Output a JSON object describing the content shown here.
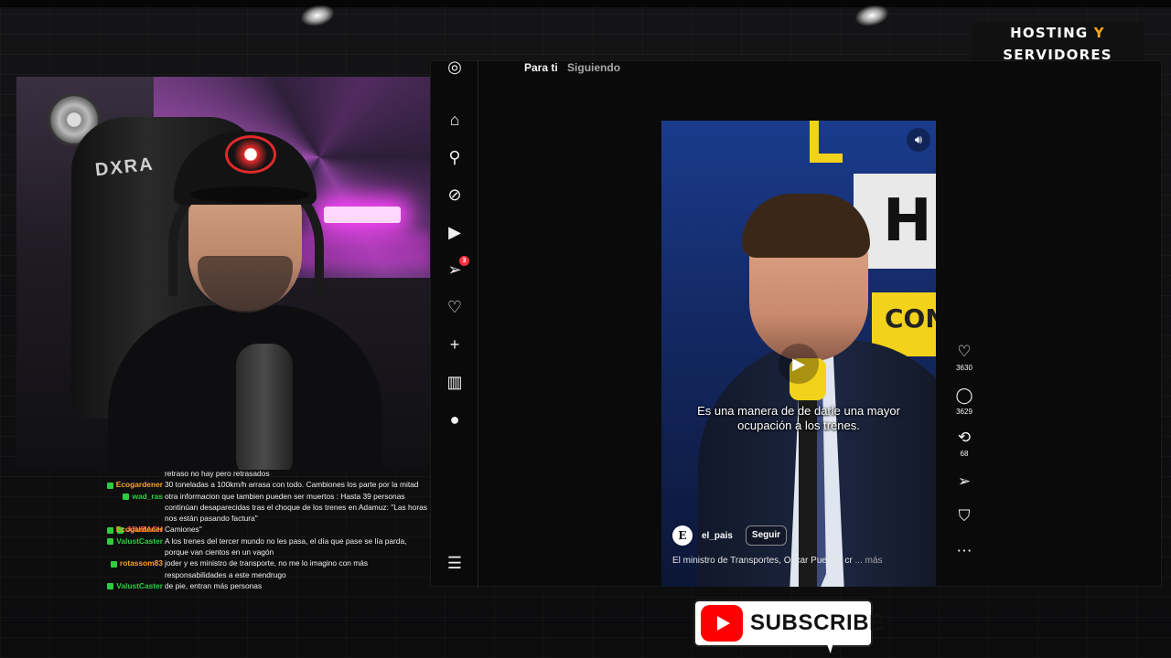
{
  "branding": {
    "line1_prefix": "HOSTING ",
    "line1_accent": "Y",
    "line2": "SERVIDORES",
    "accent_color": "#f5a623"
  },
  "webcam": {
    "chair_logo": "DXRA"
  },
  "chat": {
    "messages": [
      {
        "user": "Ecogardener",
        "user_color": "#f5a623",
        "text": "30 toneladas a 100km/h arrasa con todo. Cambiones los parte por la mitad"
      },
      {
        "user": "wad_ras",
        "user_color": "#2ecc40",
        "text": "otra informacion que tambien pueden ser muertos : Hasta 39 personas continúan desaparecidas tras el choque de los trenes en Adamuz: \"Las horas nos están pasando factura\""
      },
      {
        "user": "JJUBACH",
        "user_color": "#ff4d4d",
        "text": ""
      },
      {
        "user": "Ecogardener",
        "user_color": "#f5a623",
        "text": "Camiones\""
      },
      {
        "user": "ValustCaster",
        "user_color": "#2ecc40",
        "text": "A los trenes del tercer mundo no les pasa, el día que pase se lía parda, porque van cientos en un vagón"
      },
      {
        "user": "rotassom83",
        "user_color": "#f5a623",
        "text": "joder y es ministro de transporte, no me lo imagino con más responsabilidades a este mendrugo"
      },
      {
        "user": "ValustCaster",
        "user_color": "#2ecc40",
        "text": "de pie, entran más personas"
      }
    ],
    "partial_top": "retraso no hay pero retrasados"
  },
  "instagram": {
    "tabs": [
      "Para ti",
      "Siguiendo"
    ],
    "nav": [
      {
        "name": "instagram-logo-icon",
        "glyph": "◎"
      },
      {
        "name": "home-icon",
        "glyph": "⌂"
      },
      {
        "name": "search-icon",
        "glyph": "⚲"
      },
      {
        "name": "explore-icon",
        "glyph": "⊘"
      },
      {
        "name": "reels-icon",
        "glyph": "▶"
      },
      {
        "name": "messages-icon",
        "glyph": "➢",
        "badge": "3"
      },
      {
        "name": "notifications-icon",
        "glyph": "♡"
      },
      {
        "name": "create-icon",
        "glyph": "+"
      },
      {
        "name": "dashboard-icon",
        "glyph": "▥"
      },
      {
        "name": "profile-avatar-icon",
        "glyph": "●"
      },
      {
        "name": "menu-icon",
        "glyph": "☰"
      }
    ],
    "reel": {
      "set_letter": "H",
      "set_text": "CON",
      "subtitle": "Es una manera de de darle una mayor ocupación a los trenes.",
      "username": "el_pais",
      "avatar_letter": "E",
      "follow_label": "Seguir",
      "caption": "El ministro de Transportes, Óscar Puente, cr",
      "caption_more": "... más"
    },
    "actions": {
      "likes": "3630",
      "comments": "3629",
      "reposts": "68"
    }
  },
  "subscribe": {
    "label": "SUBSCRIBE"
  }
}
